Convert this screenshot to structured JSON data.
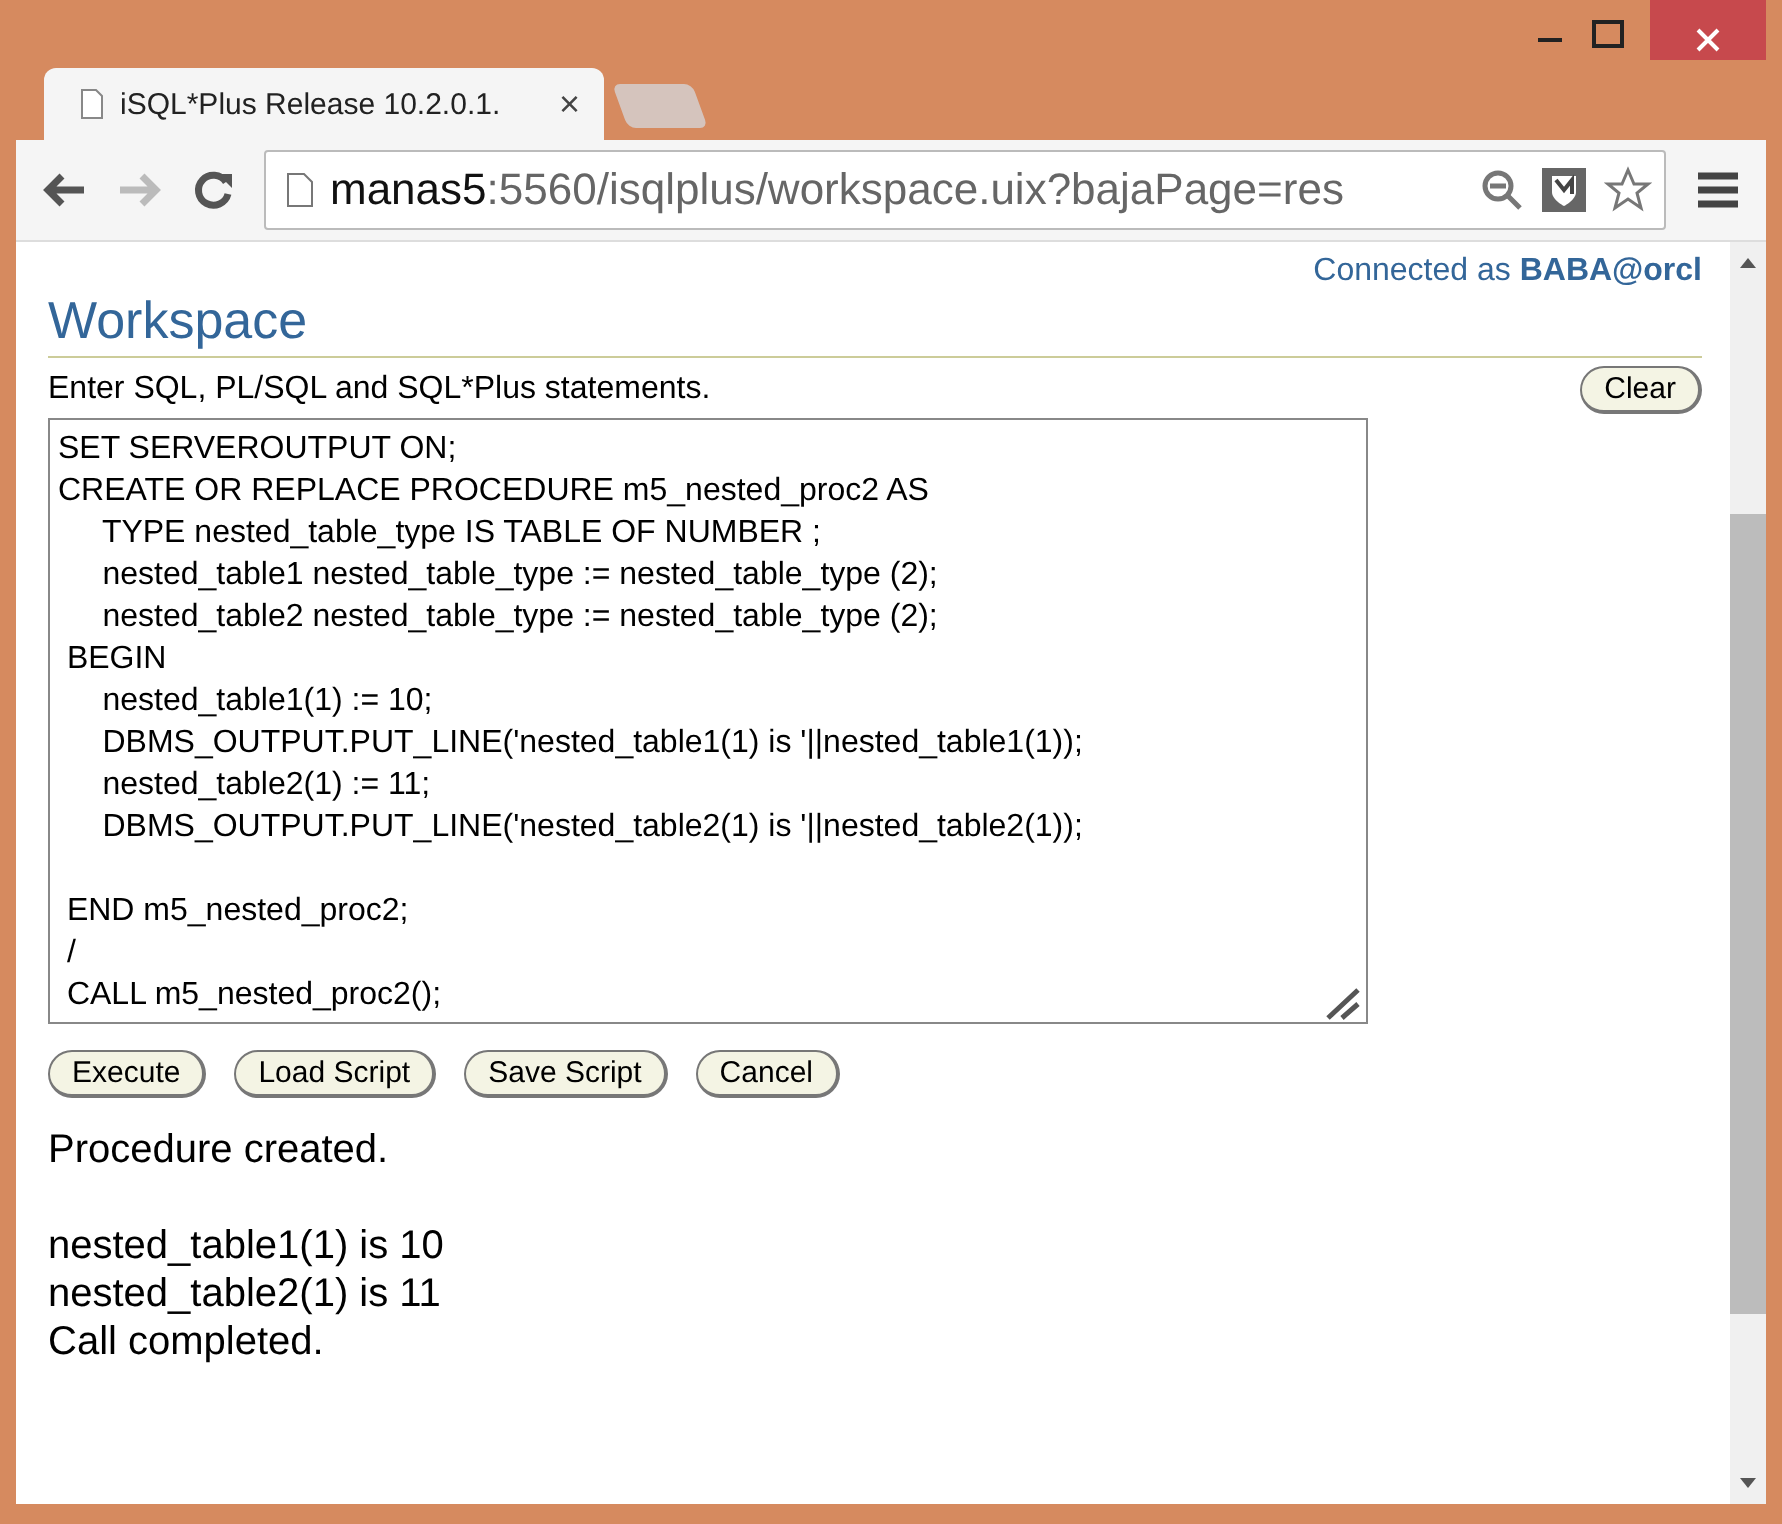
{
  "browser": {
    "tab_title": "iSQL*Plus Release 10.2.0.1.",
    "tab_close": "×",
    "url_host": "manas5",
    "url_rest": ":5560/isqlplus/workspace.uix?bajaPage=res"
  },
  "connection": {
    "prefix": "Connected as",
    "user": "BABA@orcl"
  },
  "heading": "Workspace",
  "instructions": "Enter SQL, PL/SQL and SQL*Plus statements.",
  "clear_button": "Clear",
  "editor": {
    "blocks": [
      [
        "SET SERVEROUTPUT ON;",
        "CREATE OR REPLACE PROCEDURE m5_nested_proc2 AS",
        "     TYPE nested_table_type IS TABLE OF NUMBER ;",
        "     nested_table1 nested_table_type := nested_table_type (2);",
        "     nested_table2 nested_table_type := nested_table_type (2);",
        " BEGIN",
        "     nested_table1(1) := 10;",
        "     DBMS_OUTPUT.PUT_LINE('nested_table1(1) is '||nested_table1(1));",
        "     nested_table2(1) := 11;",
        "     DBMS_OUTPUT.PUT_LINE('nested_table2(1) is '||nested_table2(1));"
      ],
      [
        " END m5_nested_proc2;",
        " /",
        " CALL m5_nested_proc2();"
      ]
    ]
  },
  "buttons": [
    "Execute",
    "Load Script",
    "Save Script",
    "Cancel"
  ],
  "output": [
    [
      "Procedure created."
    ],
    [
      "nested_table1(1) is 10",
      "nested_table2(1) is 11",
      "Call completed."
    ]
  ]
}
